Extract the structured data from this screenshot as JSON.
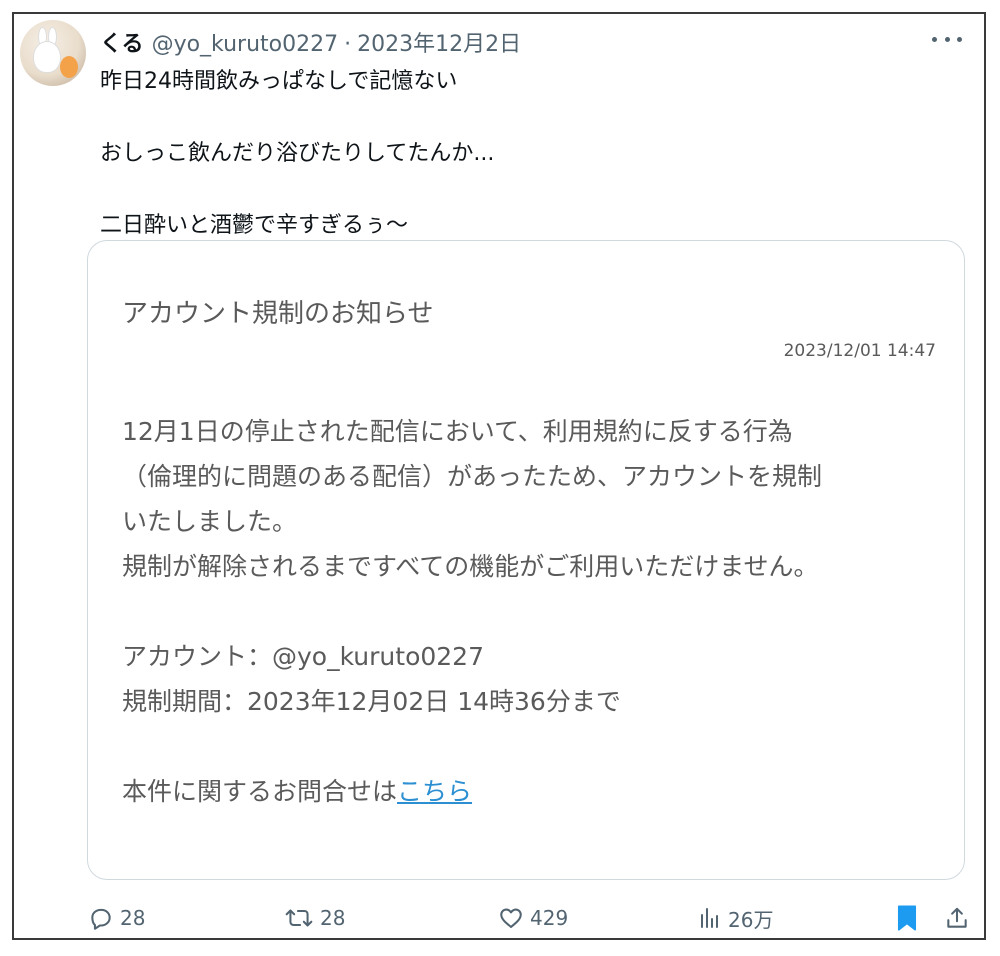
{
  "tweet": {
    "display_name": "くる",
    "handle": "@yo_kuruto0227",
    "separator": "·",
    "date": "2023年12月2日",
    "lines": [
      "昨日24時間飲みっぱなしで記憶ない",
      "",
      "おしっこ飲んだり浴びたりしてたんか...",
      "",
      "二日酔いと酒鬱で辛すぎるぅ〜"
    ]
  },
  "card": {
    "title": "アカウント規制のお知らせ",
    "timestamp": "2023/12/01 14:47",
    "body_lines": [
      "12月1日の停止された配信において、利用規約に反する行為",
      "（倫理的に問題のある配信）があったため、アカウントを規制",
      "いたしました。",
      "規制が解除されるまですべての機能がご利用いただけません。",
      "",
      "アカウント：@yo_kuruto0227",
      "規制期間：2023年12月02日 14時36分まで",
      ""
    ],
    "inquiry_prefix": "本件に関するお問合せは",
    "inquiry_link": "こちら",
    "link_color": "#2b8fd1"
  },
  "actions": {
    "reply_count": "28",
    "retweet_count": "28",
    "like_count": "429",
    "views_count": "26万"
  },
  "icons": {
    "more": "more-horizontal-icon",
    "reply": "reply-bubble-icon",
    "retweet": "retweet-arrows-icon",
    "like": "heart-icon",
    "views": "views-bar-chart-icon",
    "bookmark": "bookmark-icon",
    "share": "share-upload-icon"
  },
  "colors": {
    "bookmark": "#1d9bf0",
    "secondary_text": "#536471"
  }
}
